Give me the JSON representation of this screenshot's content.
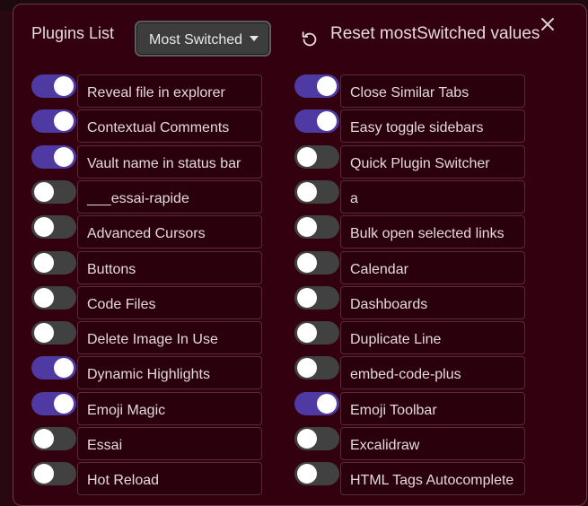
{
  "header": {
    "title": "Plugins List",
    "sort_select": {
      "value": "Most Switched"
    },
    "reset_label": "Reset mostSwitched values"
  },
  "plugins_left": [
    {
      "name": "Reveal file in explorer",
      "enabled": true
    },
    {
      "name": "Contextual Comments",
      "enabled": true
    },
    {
      "name": "Vault name in status bar",
      "enabled": true
    },
    {
      "name": "___essai-rapide",
      "enabled": false
    },
    {
      "name": "Advanced Cursors",
      "enabled": false
    },
    {
      "name": "Buttons",
      "enabled": false
    },
    {
      "name": "Code Files",
      "enabled": false
    },
    {
      "name": "Delete Image In Use",
      "enabled": false
    },
    {
      "name": "Dynamic Highlights",
      "enabled": true
    },
    {
      "name": "Emoji Magic",
      "enabled": true
    },
    {
      "name": "Essai",
      "enabled": false
    },
    {
      "name": "Hot Reload",
      "enabled": false
    }
  ],
  "plugins_right": [
    {
      "name": "Close Similar Tabs",
      "enabled": true
    },
    {
      "name": "Easy toggle sidebars",
      "enabled": true
    },
    {
      "name": "Quick Plugin Switcher",
      "enabled": false
    },
    {
      "name": "a",
      "enabled": false
    },
    {
      "name": "Bulk open selected links",
      "enabled": false
    },
    {
      "name": "Calendar",
      "enabled": false
    },
    {
      "name": "Dashboards",
      "enabled": false
    },
    {
      "name": "Duplicate Line",
      "enabled": false
    },
    {
      "name": "embed-code-plus",
      "enabled": false
    },
    {
      "name": "Emoji Toolbar",
      "enabled": true
    },
    {
      "name": "Excalidraw",
      "enabled": false
    },
    {
      "name": "HTML Tags Autocomplete",
      "enabled": false
    }
  ],
  "colors": {
    "toggle_on": "#4f3aa3",
    "toggle_off": "#414141",
    "modal_bg": "#330010",
    "item_border": "#5a2a3c"
  }
}
